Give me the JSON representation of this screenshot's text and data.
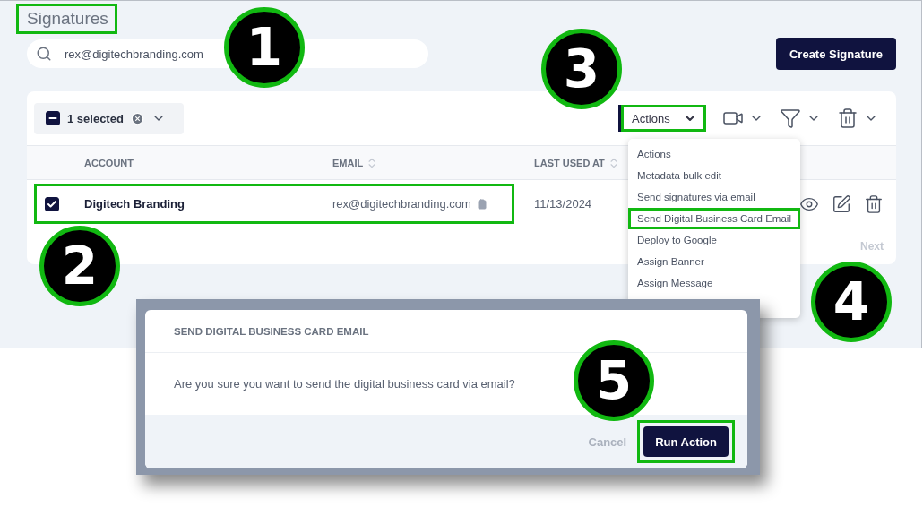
{
  "page": {
    "title": "Signatures",
    "title_highlighted": true
  },
  "search": {
    "value": "rex@digitechbranding.com"
  },
  "create_button": {
    "label": "Create Signature"
  },
  "selection": {
    "label": "1 selected",
    "checked": true
  },
  "actions_button": {
    "label": "Actions",
    "highlighted": true,
    "expanded": true
  },
  "table": {
    "columns": [
      {
        "label": "ACCOUNT",
        "sortable": false
      },
      {
        "label": "EMAIL",
        "sortable": true
      },
      {
        "label": "LAST USED AT",
        "sortable": true
      }
    ],
    "rows": [
      {
        "account": "Digitech Branding",
        "email": "rex@digitechbranding.com",
        "last_used": "11/13/2024",
        "checked": true,
        "highlighted": true
      }
    ]
  },
  "pagination": {
    "next": "Next"
  },
  "actions_menu": [
    {
      "label": "Actions",
      "highlighted": false
    },
    {
      "label": "Metadata bulk edit",
      "highlighted": false
    },
    {
      "label": "Send signatures via email",
      "highlighted": false
    },
    {
      "label": "Send Digital Business Card Email",
      "highlighted": true
    },
    {
      "label": "Deploy to Google",
      "highlighted": false
    },
    {
      "label": "Assign Banner",
      "highlighted": false
    },
    {
      "label": "Assign Message",
      "highlighted": false
    }
  ],
  "dialog": {
    "title": "SEND DIGITAL BUSINESS CARD EMAIL",
    "message": "Are you sure you want to send the digital business card via email?",
    "cancel": "Cancel",
    "confirm": "Run Action",
    "confirm_highlighted": true
  },
  "callouts": [
    {
      "number": "1"
    },
    {
      "number": "2"
    },
    {
      "number": "3"
    },
    {
      "number": "4"
    },
    {
      "number": "5"
    }
  ]
}
